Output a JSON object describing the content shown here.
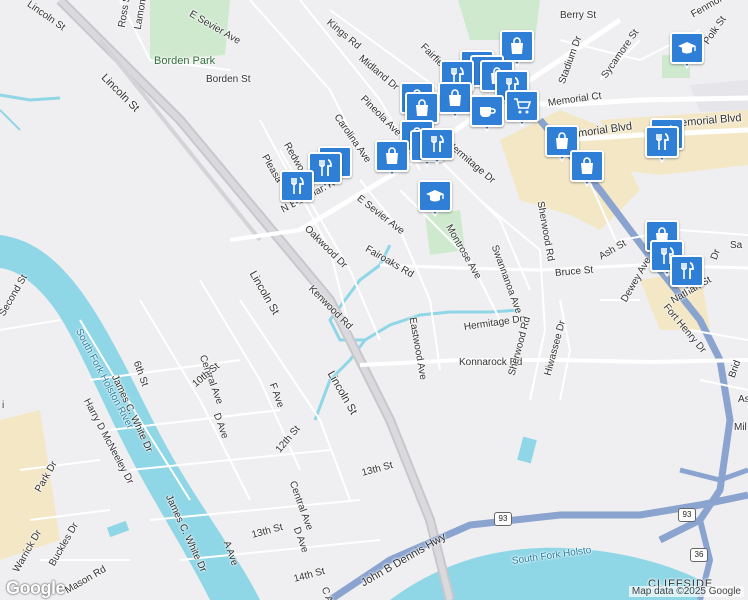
{
  "map": {
    "attribution": "Map data ©2025 Google",
    "logo": "Google",
    "park": "Borden Park",
    "river_labels": [
      "South Fork Holston River",
      "South Fork Holsto"
    ],
    "area_label": "CLIFFSIDE",
    "highways": [
      {
        "label": "93"
      },
      {
        "label": "93"
      },
      {
        "label": "36"
      }
    ],
    "streets": {
      "lincoln_st_1": "Lincoln St",
      "lincoln_st_2": "Lincoln St",
      "lincoln_st_3": "Lincoln St",
      "lincoln_st_4": "Lincoln St",
      "ross_st": "Ross St",
      "lamont_st": "Lamont St",
      "e_sevier_ave_top": "E Sevier Ave",
      "borden_st": "Borden St",
      "kings_rd": "Kings Rd",
      "midland_dr": "Midland Dr",
      "fairfield": "Fairfie",
      "pineola_ave": "Pineola Ave",
      "carolina_ave": "Carolina Ave",
      "hermitage_dr_1": "Hermitage Dr",
      "hermitage_dr_2": "Hermitage Dr",
      "john_b_dennis_hwy_top": "John B Dennis Hwy",
      "berry_st": "Berry St",
      "stadium_dr": "Stadium Dr",
      "sycamore_st": "Sycamore St",
      "polk_st": "Polk St",
      "fenmore": "Fenmore",
      "memorial_ct": "Memorial Ct",
      "memorial_blvd_1": "Memorial Blvd",
      "memorial_blvd_2": "Memorial Blvd",
      "redwood": "Redwo",
      "pleasant": "Pleasa",
      "n_eastman_rd": "N Eastman Rd",
      "e_sevier_ave": "E Sevier Ave",
      "oakwood_dr": "Oakwood Dr",
      "montrose_ave": "Montrose Ave",
      "fairoaks_rd": "Fairoaks Rd",
      "swannanoa_ave": "Swannanoa Ave",
      "sherwood_rd_1": "Sherwood Rd",
      "sherwood_rd_2": "Sherwood Rd",
      "bruce_st": "Bruce St",
      "ash_st": "Ash St",
      "kenwood_rd": "Kenwood Rd",
      "eastwood_ave": "Eastwood Ave",
      "konnarock_rd": "Konnarock Rd",
      "hiwassee_dr": "Hiwassee Dr",
      "dewey_ave": "Dewey Ave",
      "fort_henry_dr": "Fort Henry Dr",
      "nathan_st": "Nathan St",
      "second_st": "Second St",
      "sixth_st": "6th St",
      "james_c_white_dr_1": "James C. White Dr",
      "james_c_white_dr_2": "James C. White Dr",
      "harry_d_mcneeley_dr": "Harry D McNeeley Dr",
      "central_ave_1": "Central Ave",
      "central_ave_2": "Central Ave",
      "tenth_st": "10th St",
      "d_ave_1": "D Ave",
      "d_ave_2": "D Ave",
      "f_ave": "F Ave",
      "twelfth_st": "12th St",
      "thirteenth_st_1": "13th St",
      "thirteenth_st_2": "13th St",
      "fourteenth_st": "14th St",
      "a_ave": "A Ave",
      "c_ave": "C A",
      "park_dr": "Park Dr",
      "buckles_dr": "Buckles Dr",
      "warrick_dr": "Warrick Dr",
      "mason_rd": "Mason Rd",
      "john_b_dennis_hwy": "John B Dennis Hwy",
      "sa": "Sa",
      "dr_right": "Dr",
      "bridge": "Brid",
      "as": "As",
      "mil": "Mil",
      "i_left": "i"
    },
    "markers": [
      {
        "icon": "shopping-bag-icon"
      },
      {
        "icon": "shopping-bag-icon"
      },
      {
        "icon": "restaurant-icon"
      },
      {
        "icon": "restaurant-icon"
      },
      {
        "icon": "shopping-bag-icon"
      },
      {
        "icon": "restaurant-icon"
      },
      {
        "icon": "shopping-bag-icon"
      },
      {
        "icon": "shopping-bag-icon"
      },
      {
        "icon": "shopping-bag-icon"
      },
      {
        "icon": "coffee-icon"
      },
      {
        "icon": "shopping-cart-icon"
      },
      {
        "icon": "shopping-bag-icon"
      },
      {
        "icon": "restaurant-icon"
      },
      {
        "icon": "restaurant-icon"
      },
      {
        "icon": "shopping-bag-icon"
      },
      {
        "icon": "restaurant-icon"
      },
      {
        "icon": "restaurant-icon"
      },
      {
        "icon": "restaurant-icon"
      },
      {
        "icon": "school-icon"
      },
      {
        "icon": "school-icon"
      },
      {
        "icon": "shopping-bag-icon"
      },
      {
        "icon": "shopping-bag-icon"
      },
      {
        "icon": "restaurant-icon"
      },
      {
        "icon": "restaurant-icon"
      },
      {
        "icon": "shopping-bag-icon"
      },
      {
        "icon": "restaurant-icon"
      },
      {
        "icon": "restaurant-icon"
      }
    ]
  }
}
